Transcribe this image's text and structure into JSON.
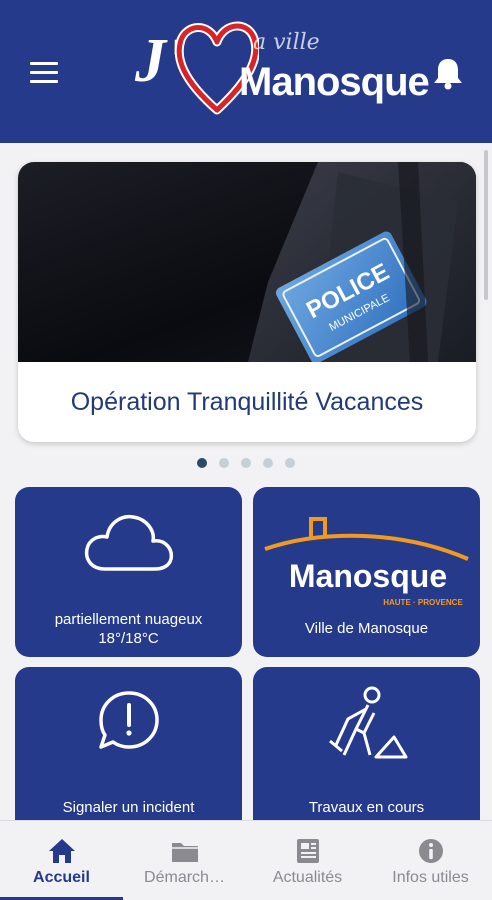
{
  "header": {
    "menu_icon": "hamburger-menu-icon",
    "notification_icon": "bell-icon",
    "logo": {
      "prefix": "J'",
      "tagline": "a ville",
      "name": "Manosque",
      "heart_color": "#d8232a"
    },
    "bg_color": "#263a8c"
  },
  "carousel": {
    "title": "Opération Tranquillité Vacances",
    "image_badge": "POLICE",
    "image_badge_sub": "MUNICIPALE",
    "slide_count": 5,
    "active_slide": 1
  },
  "tiles": [
    {
      "icon": "cloud-icon",
      "label_line1": "partiellement nuageux",
      "label_line2": "18°/18°C"
    },
    {
      "icon": "manosque-logo-icon",
      "logo_text": "Manosque",
      "logo_sub": "HAUTE · PROVENCE",
      "label": "Ville de Manosque",
      "accent_color": "#f39a1e"
    },
    {
      "icon": "speech-exclamation-icon",
      "label": "Signaler un incident"
    },
    {
      "icon": "construction-worker-icon",
      "label": "Travaux en cours"
    }
  ],
  "bottom_nav": {
    "items": [
      {
        "label": "Accueil",
        "icon": "home-icon",
        "active": true
      },
      {
        "label": "Démarch…",
        "icon": "folder-icon",
        "active": false
      },
      {
        "label": "Actualités",
        "icon": "newspaper-icon",
        "active": false
      },
      {
        "label": "Infos utiles",
        "icon": "info-icon",
        "active": false
      }
    ]
  }
}
